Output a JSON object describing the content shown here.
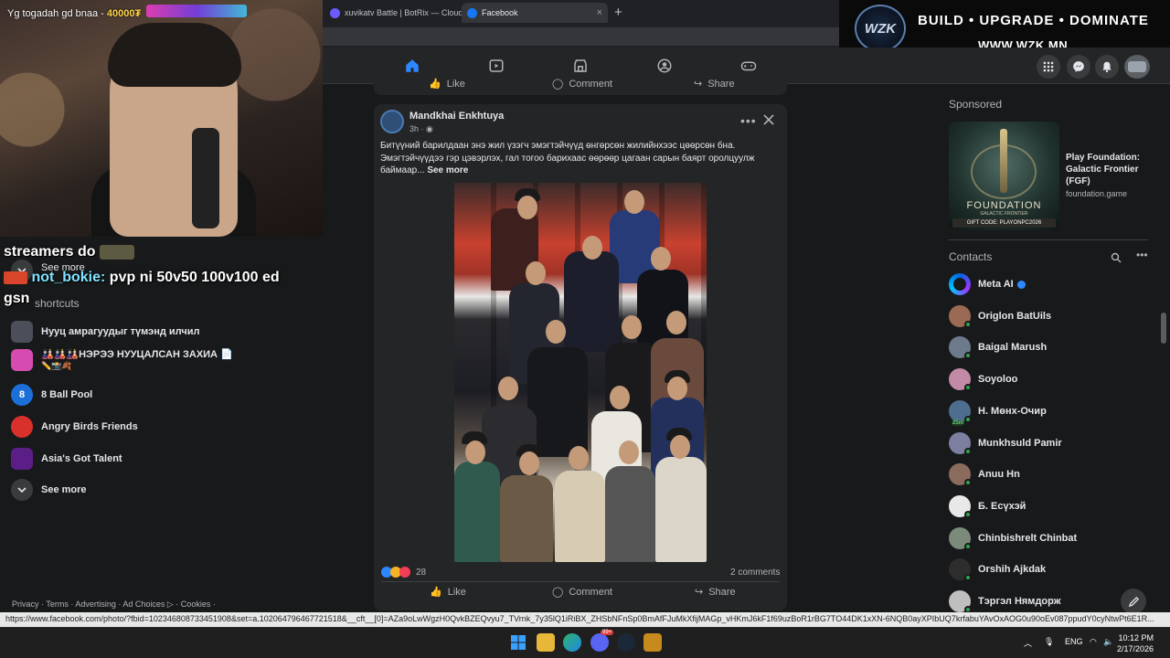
{
  "stream": {
    "donation_text": "Yg togadah gd bnaa - ",
    "donation_amount": "40000₮"
  },
  "browser": {
    "tabs": [
      {
        "label": "xuvikatv Battle | BotRix — Cloud S"
      },
      {
        "label": "Facebook"
      }
    ],
    "new_tab": "+",
    "close": "×"
  },
  "ad_banner": {
    "logo": "WZK",
    "tagline": "BUILD • UPGRADE • DOMINATE",
    "url": "WWW.WZK.MN"
  },
  "chat_overlay": {
    "line1": "streamers do",
    "user": "not_bokie:",
    "message": "pvp ni 50v50 100v100 ed",
    "line3": "gsn"
  },
  "left_sidebar": {
    "see_more_top": "See more",
    "shortcuts_heading": "shortcuts",
    "shortcuts": [
      {
        "label": "Нууц амрагуудыг түмэнд илчил"
      },
      {
        "label": "🎎🎎🎎НЭРЭЭ НУУЦАЛСАН ЗАХИА 📄"
      },
      {
        "label": "8 Ball Pool"
      },
      {
        "label": "Angry Birds Friends"
      },
      {
        "label": "Asia's Got Talent"
      }
    ],
    "shortcut_sub": "✏️📸🍂",
    "see_more": "See more",
    "footer": "Privacy · Terms · Advertising · Ad Choices ▷ · Cookies ·"
  },
  "feed": {
    "prev_actions": {
      "like": "Like",
      "comment": "Comment",
      "share": "Share"
    },
    "post": {
      "author": "Mandkhai Enkhtuya",
      "time": "3h · ",
      "text": "Битүүний барилдаан энэ жил үзэгч эмэгтэйчүүд өнгөрсөн жилийнхээс цөөрсөн бна. Эмэгтэйчүүдээ гэр цэвэрлэх, гал тогоо барихаас өөрөөр цагаан сарын баярт оролцуулж баймаар...",
      "see_more": "See more",
      "reaction_count": "28",
      "comments": "2 comments",
      "like": "Like",
      "comment": "Comment",
      "share": "Share"
    }
  },
  "right_sidebar": {
    "sponsored_heading": "Sponsored",
    "ad": {
      "title": "Play Foundation: Galactic Frontier (FGF)",
      "domain": "foundation.game",
      "image_title": "FOUNDATION",
      "image_sub": "GALACTIC FRONTIER",
      "gift_code": "GIFT CODE: PLAYONPC2026"
    },
    "contacts_heading": "Contacts",
    "contacts": [
      {
        "name": "Meta AI",
        "color": "#5b6bff"
      },
      {
        "name": "Origlon BatUils",
        "color": "#9a6a55"
      },
      {
        "name": "Baigal Marush",
        "color": "#6c7a8c"
      },
      {
        "name": "Soyoloo",
        "color": "#c28aa6"
      },
      {
        "name": "Н. Мөнх-Очир",
        "color": "#4f6e8f",
        "badge": "25m"
      },
      {
        "name": "Munkhsuld Pamir",
        "color": "#7d7fa0"
      },
      {
        "name": "Anuu Hn",
        "color": "#8b6b5c"
      },
      {
        "name": "Б. Есүхэй",
        "color": "#e8e8e8"
      },
      {
        "name": "Chinbishrelt Chinbat",
        "color": "#7b8a7a"
      },
      {
        "name": "Orshih Ajkdak",
        "color": "#2d2d2d"
      },
      {
        "name": "Тэргэл Нямдорж",
        "color": "#bfbfbf"
      }
    ]
  },
  "status_bar": {
    "url": "https://www.facebook.com/photo/?fbid=102346808733451908&set=a.102064796467721518&__cft__[0]=AZa9oLwWgzH0QvkBZEQvyu7_TVrnk_7y35lQ1iRiBX_ZHSbNFnSp0BmAfFJuMkXfijMAGp_vHKmJ6kF1f69uzBoR1rBG7TO44DK1xXN-6NQB0ayXPIbUQ7krfabuYAvOxAOG0u90oEv087ppudY0cyNtwPt6E1R..."
  },
  "taskbar": {
    "lang": "ENG",
    "time": "10:12 PM",
    "date": "2/17/2026",
    "badge": "99+"
  },
  "colors": {
    "fb_blue": "#2d88ff",
    "online_green": "#31a24c",
    "bg": "#18191a",
    "card": "#242526"
  }
}
